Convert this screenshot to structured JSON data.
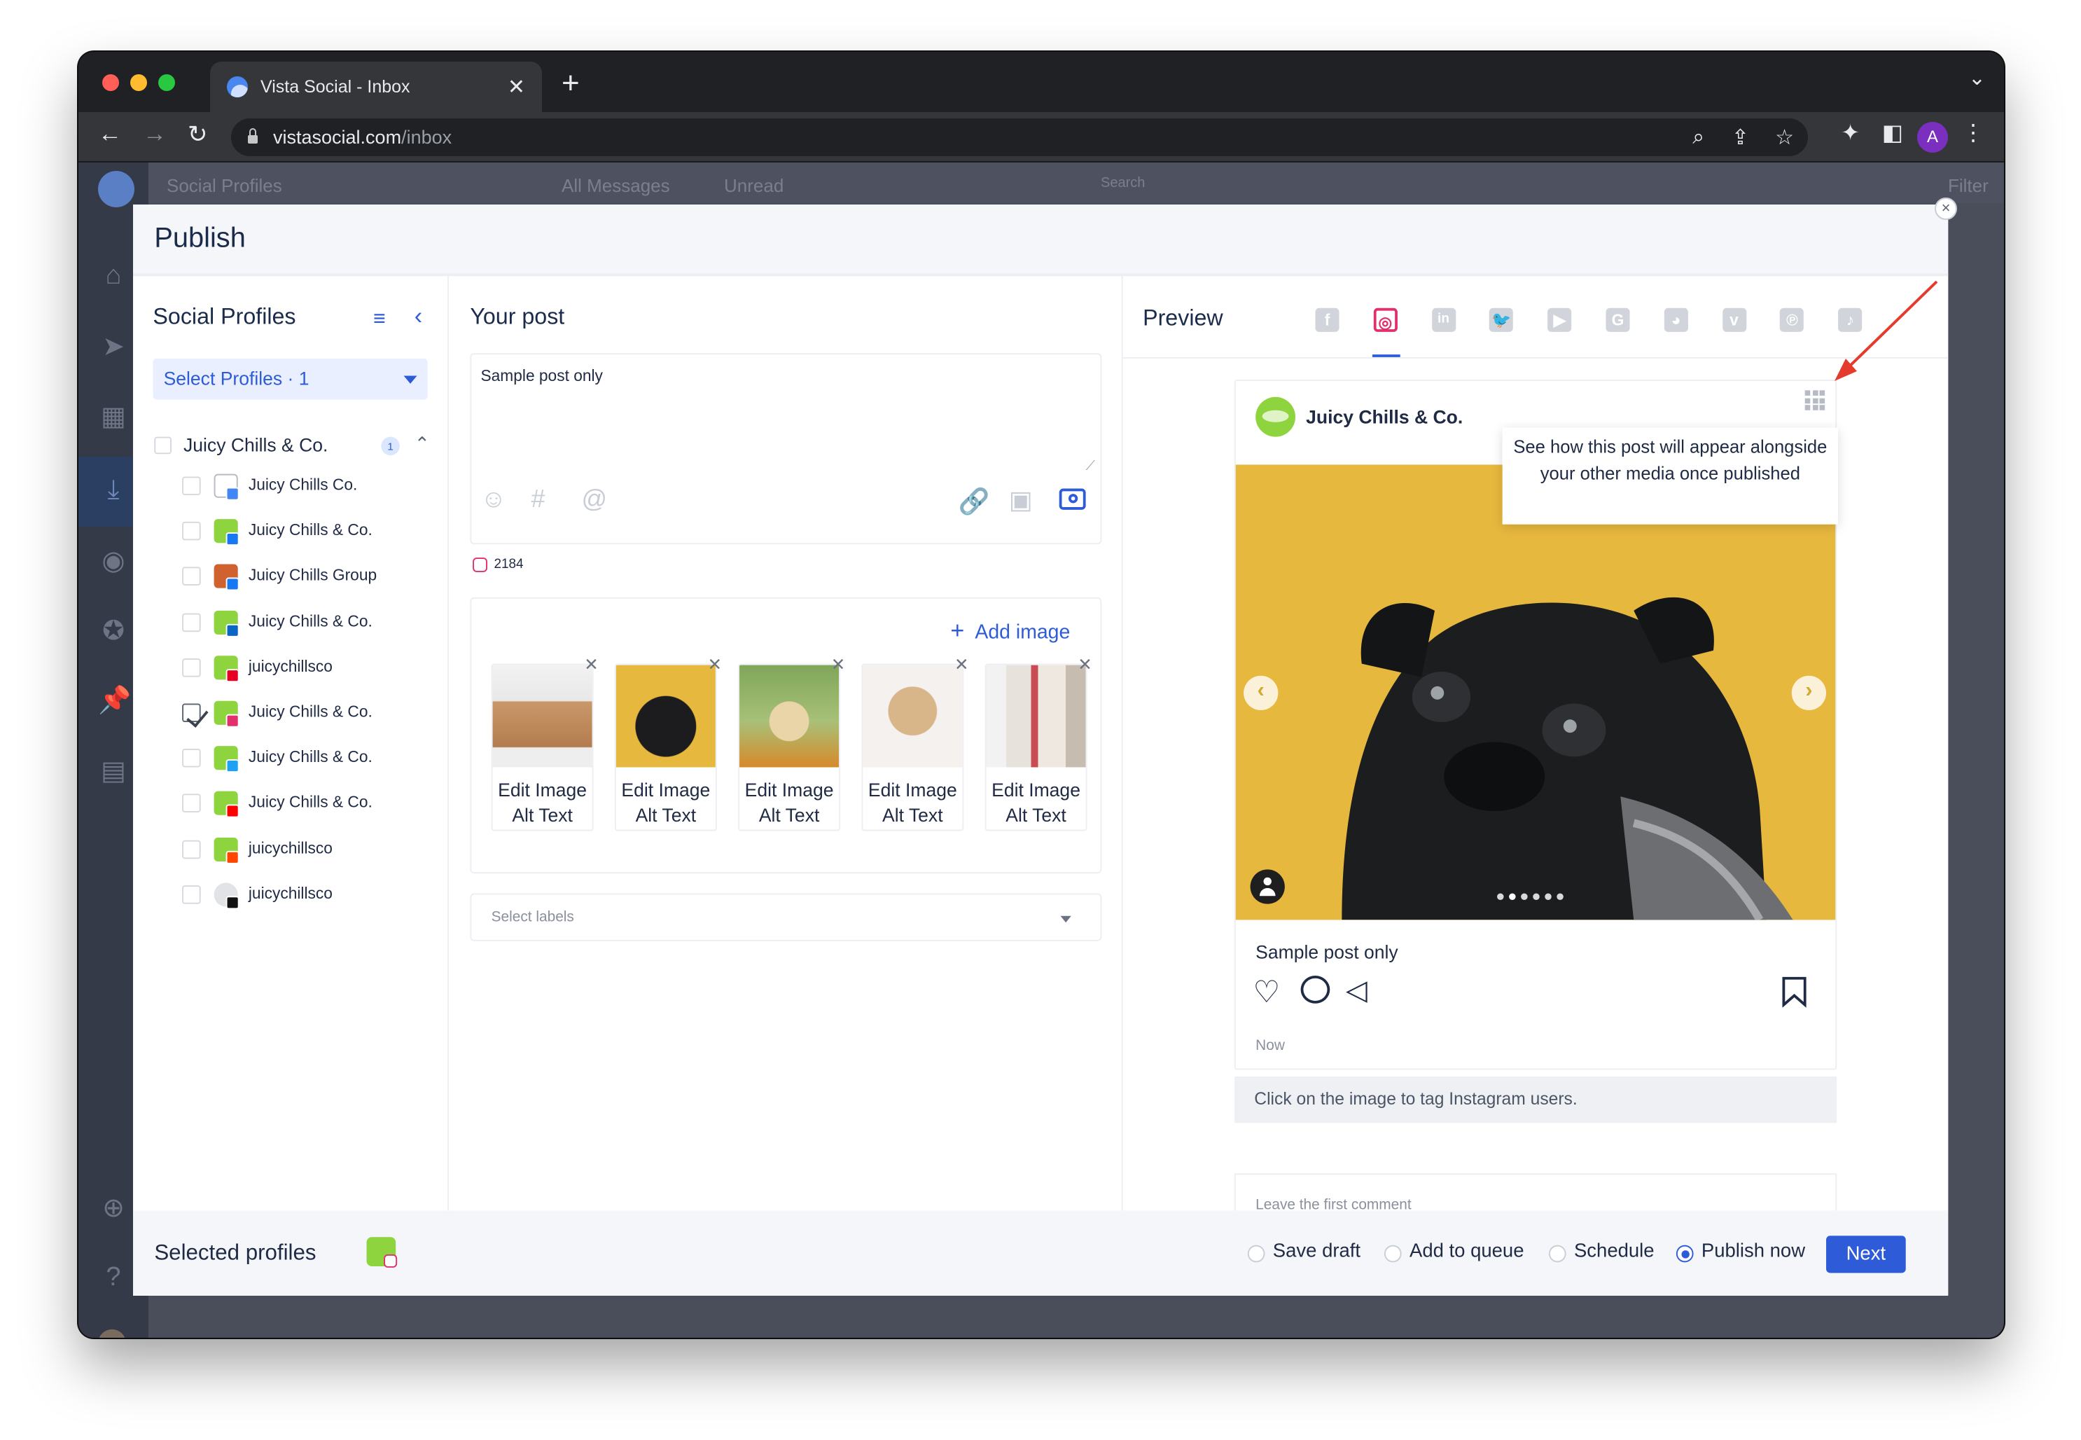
{
  "browser": {
    "tab_title": "Vista Social - Inbox",
    "url_host": "vistasocial.com",
    "url_path": "/inbox",
    "profile_initial": "A"
  },
  "background_app": {
    "header_items": [
      "Social Profiles",
      "All Messages",
      "Unread",
      "Search",
      "Filter"
    ]
  },
  "modal": {
    "title": "Publish",
    "close_label": "×"
  },
  "social_profiles": {
    "title": "Social Profiles",
    "select_label": "Select Profiles · 1",
    "group": {
      "name": "Juicy Chills & Co.",
      "count": "1"
    },
    "profiles": [
      {
        "name": "Juicy Chills Co.",
        "network": "google",
        "checked": false
      },
      {
        "name": "Juicy Chills & Co.",
        "network": "facebook",
        "checked": false
      },
      {
        "name": "Juicy Chills Group",
        "network": "facebook",
        "checked": false
      },
      {
        "name": "Juicy Chills & Co.",
        "network": "linkedin",
        "checked": false
      },
      {
        "name": "juicychillsco",
        "network": "pinterest",
        "checked": false
      },
      {
        "name": "Juicy Chills & Co.",
        "network": "instagram",
        "checked": true
      },
      {
        "name": "Juicy Chills & Co.",
        "network": "twitter",
        "checked": false
      },
      {
        "name": "Juicy Chills & Co.",
        "network": "youtube",
        "checked": false
      },
      {
        "name": "juicychillsco",
        "network": "reddit",
        "checked": false
      },
      {
        "name": "juicychillsco",
        "network": "tiktok",
        "checked": false
      }
    ]
  },
  "your_post": {
    "title": "Your post",
    "text": "Sample post only",
    "char_count": "2184",
    "add_image_label": "Add image",
    "media": [
      {
        "line1": "Edit Image",
        "line2": "Alt Text"
      },
      {
        "line1": "Edit Image",
        "line2": "Alt Text"
      },
      {
        "line1": "Edit Image",
        "line2": "Alt Text"
      },
      {
        "line1": "Edit Image",
        "line2": "Alt Text"
      },
      {
        "line1": "Edit Image",
        "line2": "Alt Text"
      }
    ],
    "labels_placeholder": "Select labels"
  },
  "preview": {
    "title": "Preview",
    "networks": [
      "facebook",
      "instagram",
      "linkedin",
      "twitter",
      "youtube",
      "google",
      "reddit",
      "vimeo",
      "pinterest",
      "tiktok"
    ],
    "active_network": "instagram",
    "account_name": "Juicy Chills & Co.",
    "tooltip": "See how this post will appear alongside your other media once published",
    "caption": "Sample post only",
    "time": "Now",
    "tag_hint": "Click on the image to tag Instagram users.",
    "first_comment_placeholder": "Leave the first comment",
    "carousel_count": 6,
    "carousel_index": 1
  },
  "footer": {
    "selected_profiles_label": "Selected profiles",
    "options": [
      {
        "label": "Save draft",
        "selected": false
      },
      {
        "label": "Add to queue",
        "selected": false
      },
      {
        "label": "Schedule",
        "selected": false
      },
      {
        "label": "Publish now",
        "selected": true
      }
    ],
    "next_label": "Next"
  },
  "colors": {
    "accent": "#2e5bd8",
    "instagram": "#e1306c",
    "brand_green": "#8ed43e",
    "annotation": "#e53b2c",
    "preview_bg": "#e7b83e"
  }
}
